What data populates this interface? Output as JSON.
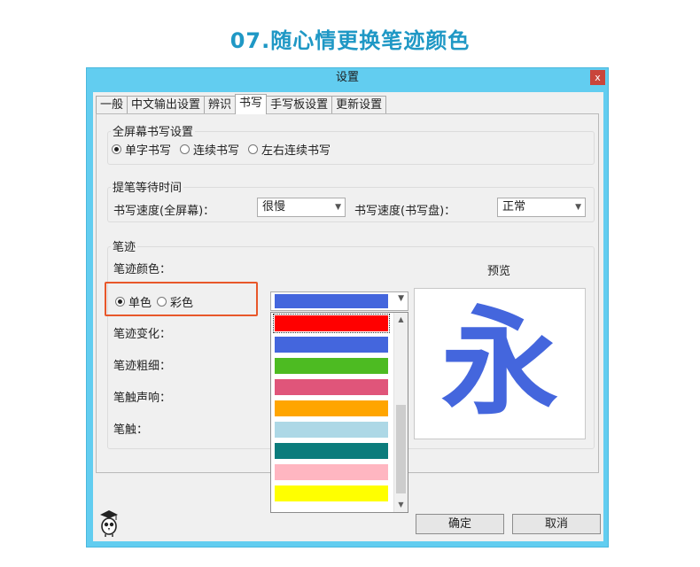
{
  "headline": "07.随心情更换笔迹颜色",
  "window": {
    "title": "设置",
    "close": "x"
  },
  "tabs": [
    "一般",
    "中文输出设置",
    "辨识",
    "书写",
    "手写板设置",
    "更新设置"
  ],
  "fullscreen_group": {
    "title": "全屏幕书写设置",
    "options": [
      "单字书写",
      "连续书写",
      "左右连续书写"
    ],
    "selected": "单字书写"
  },
  "wait_group": {
    "title": "提笔等待时间",
    "fullscreen_speed_label": "书写速度(全屏幕)：",
    "fullscreen_speed_value": "很慢",
    "pad_speed_label": "书写速度(书写盘)：",
    "pad_speed_value": "正常"
  },
  "stroke_group": {
    "title": "笔迹",
    "color_label": "笔迹颜色：",
    "mode_options": [
      "单色",
      "彩色"
    ],
    "mode_selected": "单色",
    "variation_label": "笔迹变化：",
    "thickness_label": "笔迹粗细：",
    "sound_label": "笔触声响：",
    "touch_label": "笔触：",
    "preview_label": "预览",
    "preview_char": "永",
    "selected_color": "#4466dd",
    "color_options": [
      "#ff0000",
      "#4466dd",
      "#4dbb22",
      "#e0557a",
      "#ffa500",
      "#add8e6",
      "#0b7c7c",
      "#ffb6c1",
      "#ffff00"
    ]
  },
  "buttons": {
    "ok": "确定",
    "cancel": "取消"
  },
  "icons": {
    "close": "close-icon",
    "dropdown": "chevron-down-icon",
    "logo": "owl-logo-icon"
  }
}
